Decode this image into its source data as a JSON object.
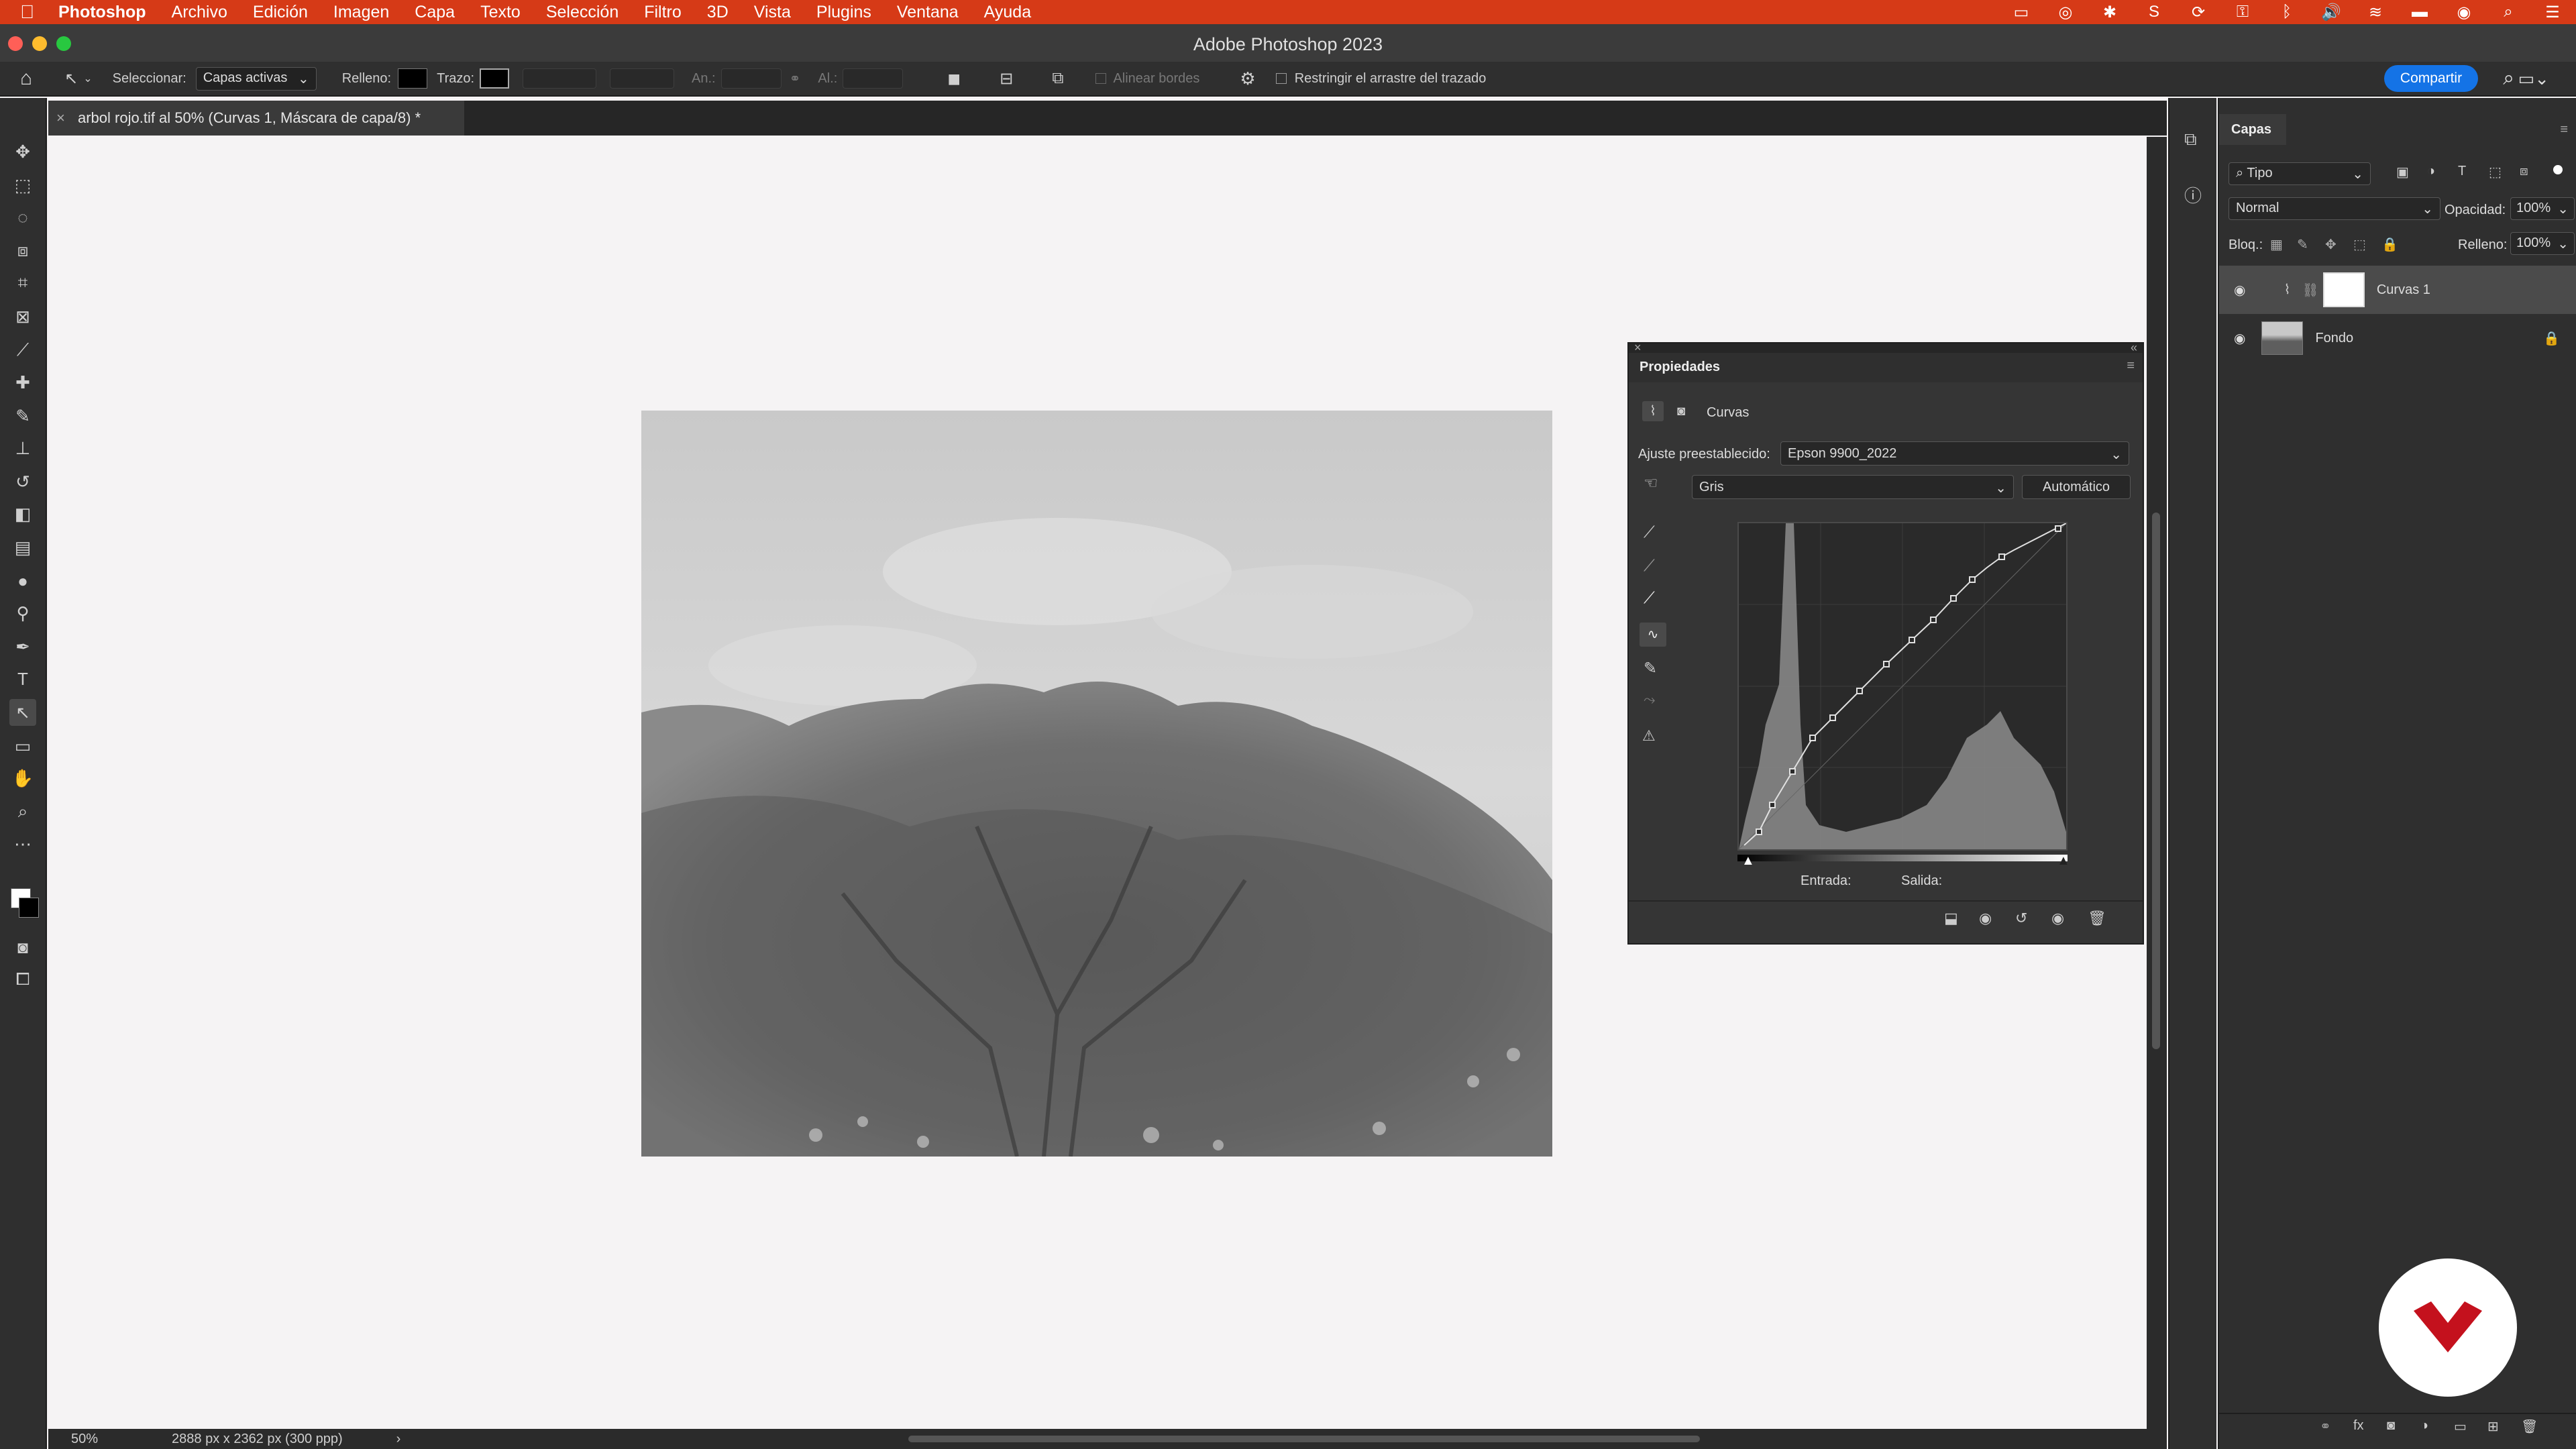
{
  "menubar": {
    "items": [
      "Photoshop",
      "Archivo",
      "Edición",
      "Imagen",
      "Capa",
      "Texto",
      "Selección",
      "Filtro",
      "3D",
      "Vista",
      "Plugins",
      "Ventana",
      "Ayuda"
    ]
  },
  "window": {
    "title": "Adobe Photoshop 2023"
  },
  "options": {
    "select_label": "Seleccionar:",
    "select_value": "Capas activas",
    "fill_label": "Relleno:",
    "stroke_label": "Trazo:",
    "width_label": "An.:",
    "height_label": "Al.:",
    "align_edges": "Alinear bordes",
    "restrict_drag": "Restringir el arrastre del trazado",
    "share": "Compartir"
  },
  "document": {
    "tab_title": "arbol rojo.tif al 50% (Curvas 1, Máscara de capa/8) *",
    "zoom": "50%",
    "size_info": "2888 px x 2362 px (300 ppp)"
  },
  "properties": {
    "title": "Propiedades",
    "section": "Curvas",
    "preset_label": "Ajuste preestablecido:",
    "preset_value": "Epson 9900_2022",
    "channel_value": "Gris",
    "auto_button": "Automático",
    "input_label": "Entrada:",
    "output_label": "Salida:"
  },
  "layers": {
    "title": "Capas",
    "filter_type": "Tipo",
    "blend_mode": "Normal",
    "opacity_label": "Opacidad:",
    "opacity_value": "100%",
    "lock_label": "Bloq.:",
    "fill_label": "Relleno:",
    "fill_value": "100%",
    "items": [
      {
        "name": "Curvas 1"
      },
      {
        "name": "Fondo"
      }
    ]
  },
  "colors": {
    "menubar": "#d63a17",
    "accent_blue": "#1473e6",
    "panel": "#2f2f2f"
  }
}
